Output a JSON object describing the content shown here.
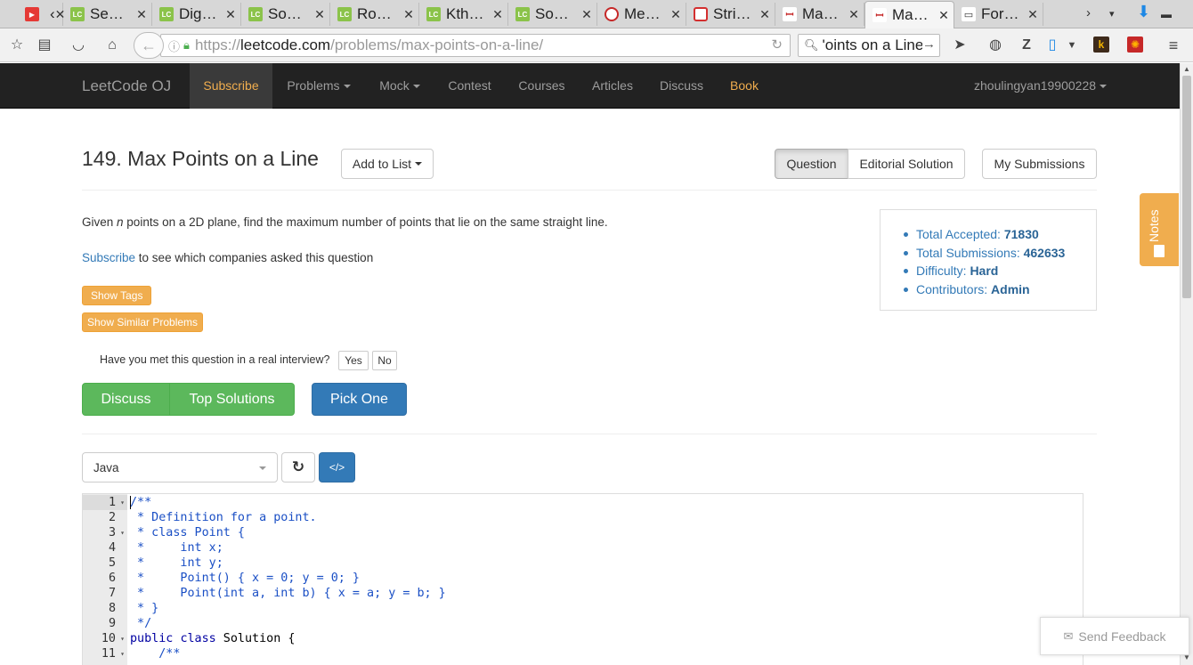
{
  "browser": {
    "tabs": [
      {
        "label": "",
        "icon": "youtube-audio-icon",
        "icon_kind": "yt",
        "icon_text": "▶"
      },
      {
        "label": "Se…",
        "icon": "leetcode-favicon",
        "icon_kind": "lc",
        "icon_text": "LC"
      },
      {
        "label": "Dig…",
        "icon": "leetcode-favicon",
        "icon_kind": "lc",
        "icon_text": "LC"
      },
      {
        "label": "So…",
        "icon": "leetcode-favicon",
        "icon_kind": "lc",
        "icon_text": "LC"
      },
      {
        "label": "Ro…",
        "icon": "leetcode-favicon",
        "icon_kind": "lc",
        "icon_text": "LC"
      },
      {
        "label": "Kth…",
        "icon": "leetcode-favicon",
        "icon_kind": "lc",
        "icon_text": "LC"
      },
      {
        "label": "So…",
        "icon": "leetcode-favicon",
        "icon_kind": "lc",
        "icon_text": "LC"
      },
      {
        "label": "Me…",
        "icon": "github-favicon",
        "icon_kind": "gh",
        "icon_text": ""
      },
      {
        "label": "Stri…",
        "icon": "oracle-favicon",
        "icon_kind": "or",
        "icon_text": ""
      },
      {
        "label": "Ma…",
        "icon": "site-favicon",
        "icon_kind": "cs",
        "icon_text": "ꟷ"
      },
      {
        "label": "Ma…",
        "icon": "site-favicon",
        "icon_kind": "cs",
        "icon_text": "ꟷ",
        "active": true
      },
      {
        "label": "For…",
        "icon": "forum-favicon",
        "icon_kind": "fr",
        "icon_text": "▭"
      }
    ],
    "url": {
      "proto": "https://",
      "host": "leetcode.com",
      "path": "/problems/max-points-on-a-line/"
    },
    "search_value": "'oints on a Line"
  },
  "site": {
    "brand": "LeetCode OJ",
    "nav": [
      {
        "label": "Subscribe",
        "style": "sub"
      },
      {
        "label": "Problems",
        "caret": true
      },
      {
        "label": "Mock",
        "caret": true
      },
      {
        "label": "Contest"
      },
      {
        "label": "Courses"
      },
      {
        "label": "Articles"
      },
      {
        "label": "Discuss"
      },
      {
        "label": "Book",
        "style": "book"
      }
    ],
    "username": "zhoulingyan19900228"
  },
  "problem": {
    "title": "149. Max Points on a Line",
    "add_to_list": "Add to List",
    "tabs": {
      "question": "Question",
      "editorial": "Editorial Solution",
      "submissions": "My Submissions"
    },
    "desc_pre": "Given ",
    "desc_var": "n",
    "desc_post": " points on a 2D plane, find the maximum number of points that lie on the same straight line.",
    "subscribe_link": "Subscribe",
    "subscribe_text": " to see which companies asked this question",
    "show_tags": "Show Tags",
    "show_similar": "Show Similar Problems",
    "interview_q": "Have you met this question in a real interview?",
    "yes": "Yes",
    "no": "No",
    "discuss": "Discuss",
    "top_solutions": "Top Solutions",
    "pick_one": "Pick One"
  },
  "stats": {
    "accepted_label": "Total Accepted:",
    "accepted": "71830",
    "submissions_label": "Total Submissions:",
    "submissions": "462633",
    "difficulty_label": "Difficulty:",
    "difficulty": "Hard",
    "contributors_label": "Contributors:",
    "contributors": "Admin"
  },
  "notes_label": "Notes",
  "editor": {
    "language": "Java",
    "lines": [
      {
        "n": "1",
        "fold": true,
        "text": "/**",
        "type": "comment"
      },
      {
        "n": "2",
        "fold": false,
        "text": " * Definition for a point.",
        "type": "comment"
      },
      {
        "n": "3",
        "fold": true,
        "text": " * class Point {",
        "type": "comment"
      },
      {
        "n": "4",
        "fold": false,
        "text": " *     int x;",
        "type": "comment"
      },
      {
        "n": "5",
        "fold": false,
        "text": " *     int y;",
        "type": "comment"
      },
      {
        "n": "6",
        "fold": false,
        "text": " *     Point() { x = 0; y = 0; }",
        "type": "comment"
      },
      {
        "n": "7",
        "fold": false,
        "text": " *     Point(int a, int b) { x = a; y = b; }",
        "type": "comment"
      },
      {
        "n": "8",
        "fold": false,
        "text": " * }",
        "type": "comment"
      },
      {
        "n": "9",
        "fold": false,
        "text": " */",
        "type": "comment"
      },
      {
        "n": "10",
        "fold": true,
        "text": "public class Solution {",
        "type": "code"
      },
      {
        "n": "11",
        "fold": true,
        "text": "    /**",
        "type": "comment"
      }
    ]
  },
  "feedback": "Send Feedback",
  "colors": {
    "brand_orange": "#f0ad4e",
    "green": "#5cb85c",
    "blue": "#337ab7",
    "navbar": "#222222"
  }
}
